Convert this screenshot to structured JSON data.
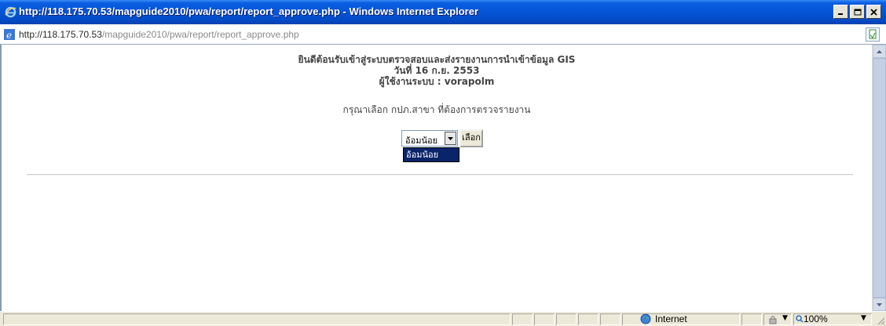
{
  "window": {
    "title": "http://118.175.70.53/mapguide2010/pwa/report/report_approve.php - Windows Internet Explorer"
  },
  "address": {
    "url_host": "http://118.175.70.53",
    "url_path": "/mapguide2010/pwa/report/report_approve.php"
  },
  "page": {
    "welcome": "ยินดีต้อนรับเข้าสู่ระบบตรวจสอบและส่งรายงานการนำเข้าข้อมูล GIS",
    "date": "วันที่ 16 ก.ย. 2553",
    "user_line": "ผู้ใช้งานระบบ : vorapolm",
    "instruction": "กรุณาเลือก กปภ.สาขา ที่ต้องการตรวจรายงาน",
    "select": {
      "value": "อ้อมน้อย",
      "options": [
        "อ้อมน้อย"
      ]
    },
    "select_button": "เลือก"
  },
  "statusbar": {
    "zone": "Internet",
    "zoom": "100%"
  },
  "colors": {
    "titlebar": "#0554d6",
    "selection": "#0a246a"
  }
}
